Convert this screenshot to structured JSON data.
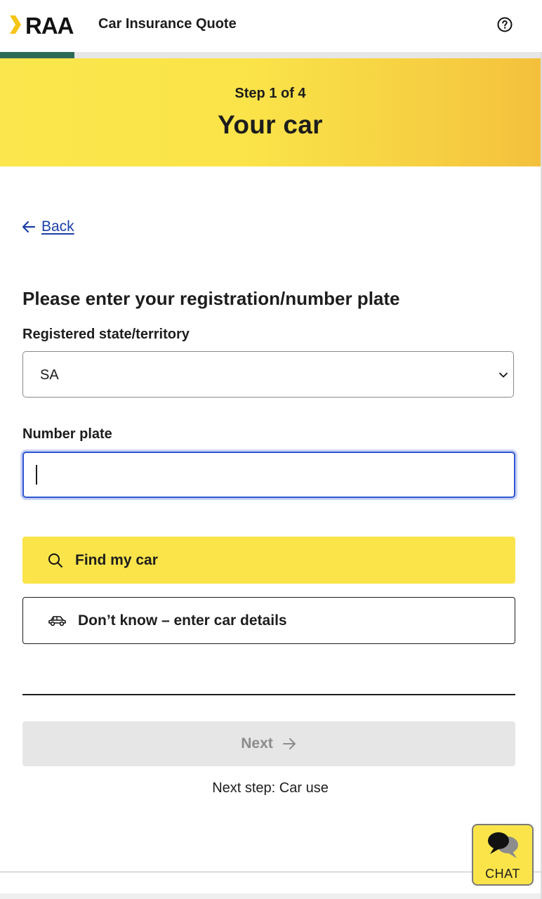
{
  "header": {
    "brand": "RAA",
    "title": "Car Insurance Quote",
    "help_icon": "question-circle-icon"
  },
  "progress": {
    "fraction": 0.25
  },
  "hero": {
    "step_label": "Step 1 of 4",
    "title": "Your car"
  },
  "back": {
    "label": "Back",
    "icon": "arrow-left-icon"
  },
  "form": {
    "question": "Please enter your registration/number plate",
    "state_label": "Registered state/territory",
    "state_value": "SA",
    "plate_label": "Number plate",
    "plate_value": ""
  },
  "buttons": {
    "find_label": "Find my car",
    "find_icon": "search-icon",
    "dont_know_label": "Don’t know – enter car details",
    "dont_know_icon": "car-icon",
    "next_label": "Next",
    "next_icon": "arrow-right-icon"
  },
  "next_step": "Next step: Car use",
  "chat": {
    "label": "CHAT",
    "icon": "chat-bubbles-icon"
  },
  "colors": {
    "brand_yellow": "#fae44a",
    "progress_green": "#2e6b57",
    "link_blue": "#1a3fa8",
    "focus_blue": "#2f55d4"
  }
}
